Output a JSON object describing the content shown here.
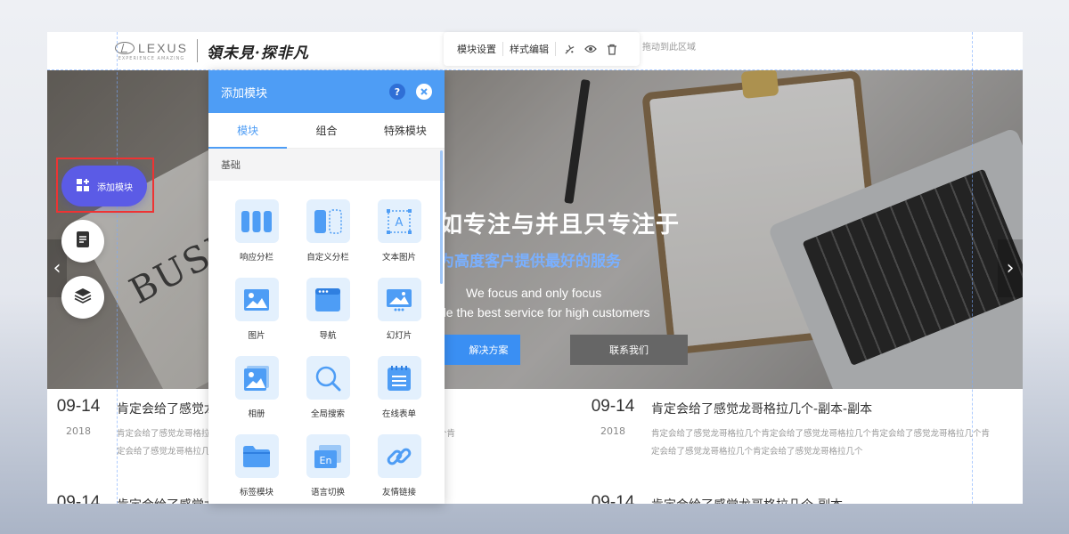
{
  "header": {
    "brand_word": "LEXUS",
    "brand_tagline": "EXPERIENCE AMAZING",
    "slogan": "領未見·探非凡",
    "drag_hint": "拖动到此区域"
  },
  "toolbar": {
    "module_settings": "模块设置",
    "style_edit": "样式编辑"
  },
  "banner": {
    "title": "如专注与并且只专注于",
    "subtitle": "为高度客户提供最好的服务",
    "en_line1": "We focus and only focus",
    "en_line2": "de the best service for high customers",
    "btn_solution": "解决方案",
    "btn_contact": "联系我们",
    "newspaper_text": "BUSINESS"
  },
  "news": [
    {
      "day": "09-14",
      "year": "2018",
      "title": "肯定会给了感觉龙哥格拉几个-副本-副本",
      "desc": "肯定会给了感觉龙哥格拉几个肯定会给了感觉龙哥格拉几个肯定会给了感觉龙哥格拉几个肯定会给了感觉龙哥格拉几个肯定会给了感觉龙哥格拉几个"
    },
    {
      "day": "09-14",
      "year": "2018",
      "title": "肯定会给了感觉龙哥格拉几个-副本-副本",
      "desc": "肯定会给了感觉龙哥格拉几个肯定会给了感觉龙哥格拉几个肯定会给了感觉龙哥格拉几个肯定会给了感觉龙哥格拉几个肯定会给了感觉龙哥格拉几个"
    },
    {
      "day": "09-14",
      "title": "肯定会给了感觉龙哥格拉几个-副本"
    },
    {
      "day": "09-14",
      "title": "肯定会给了感觉龙哥格拉几个-副本"
    }
  ],
  "float_buttons": {
    "add_module": "添加模块"
  },
  "panel": {
    "title": "添加模块",
    "help": "?",
    "tabs": [
      "模块",
      "组合",
      "特殊模块"
    ],
    "active_tab": "模块",
    "section": "基础",
    "modules": [
      {
        "label": "响应分栏",
        "icon": "columns-icon"
      },
      {
        "label": "自定义分栏",
        "icon": "custom-columns-icon"
      },
      {
        "label": "文本图片",
        "icon": "text-image-icon"
      },
      {
        "label": "图片",
        "icon": "image-icon"
      },
      {
        "label": "导航",
        "icon": "navigation-icon"
      },
      {
        "label": "幻灯片",
        "icon": "slideshow-icon"
      },
      {
        "label": "相册",
        "icon": "album-icon"
      },
      {
        "label": "全局搜索",
        "icon": "search-icon"
      },
      {
        "label": "在线表单",
        "icon": "form-icon"
      },
      {
        "label": "标签模块",
        "icon": "tab-module-icon"
      },
      {
        "label": "语言切换",
        "icon": "language-icon"
      },
      {
        "label": "友情链接",
        "icon": "link-icon"
      }
    ]
  },
  "colors": {
    "accent": "#4e9df5",
    "add_button": "#5b5be6",
    "highlight": "#ee3333",
    "hero_subtitle": "#7ab0ff",
    "contact_button": "#666666"
  }
}
